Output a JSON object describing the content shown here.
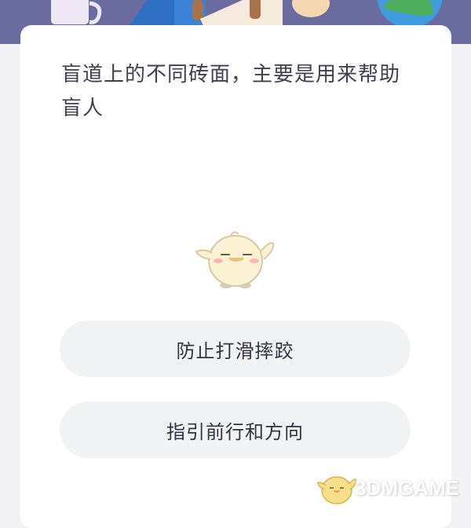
{
  "question": {
    "text": "盲道上的不同砖面，主要是用来帮助盲人"
  },
  "options": [
    {
      "label": "防止打滑摔跤"
    },
    {
      "label": "指引前行和方向"
    }
  ],
  "illustration": {
    "banner_icons": [
      "cup-icon",
      "person-icon",
      "globe-icon"
    ],
    "mascot_icon": "chick-mascot-icon"
  },
  "watermark": {
    "text": "3DMGAME"
  },
  "colors": {
    "banner": "#6a6b9f",
    "background": "#f3f3f6",
    "card": "#ffffff",
    "option_bg": "#f2f3f5",
    "text": "#3f3f4f"
  }
}
